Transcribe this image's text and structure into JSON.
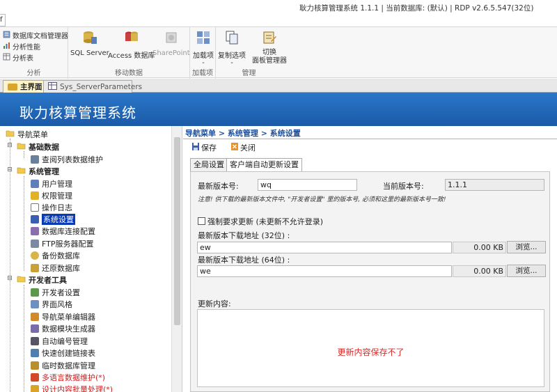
{
  "window": {
    "title": "耿力核算管理系统 1.1.1 | 当前数据库: (默认) | RDP v2.6.5.547(32位)",
    "tab_mark": "f"
  },
  "ribbon": {
    "groups": [
      {
        "name": "分析",
        "items": [
          "数据库文档管理器",
          "分析性能",
          "分析表"
        ]
      },
      {
        "name": "移动数据",
        "items": [
          "SQL Server",
          "Access 数据库",
          "SharePoint"
        ]
      },
      {
        "name": "加载项",
        "items": [
          "加载项"
        ]
      },
      {
        "name": "管理",
        "items": [
          "复制选项",
          "切换\n面板管理器"
        ]
      }
    ],
    "dropdown_marks": [
      "-",
      "-"
    ],
    "switch_line1": "切换",
    "switch_line2": "面板管理器"
  },
  "doc_tabs": [
    {
      "label": "主界面",
      "active": true
    },
    {
      "label": "Sys_ServerParameters",
      "active": false
    }
  ],
  "banner": {
    "title": "耿力核算管理系统"
  },
  "nav": {
    "root": "导航菜单",
    "categories": [
      {
        "label": "基础数据",
        "items": [
          "查阅列表数据维护"
        ]
      },
      {
        "label": "系统管理",
        "items": [
          "用户管理",
          "权限管理",
          "操作日志",
          "系统设置",
          "数据库连接配置",
          "FTP服务器配置",
          "备份数据库",
          "还原数据库"
        ]
      },
      {
        "label": "开发者工具",
        "items": [
          "开发者设置",
          "界面风格",
          "导航菜单编辑器",
          "数据模块生成器",
          "自动编号管理",
          "快速创建链接表",
          "临时数据库管理",
          "多语言数据维护(*)",
          "设计内容批量处理(*)"
        ]
      }
    ],
    "selected": "系统设置"
  },
  "main": {
    "breadcrumb": "导航菜单 > 系统管理 > 系统设置",
    "toolbar": {
      "save": "保存",
      "close": "关闭"
    },
    "tabs": [
      "全局设置",
      "客户端自动更新设置"
    ],
    "active_tab": "客户端自动更新设置",
    "form": {
      "latest_version_label": "最新版本号:",
      "latest_version_value": "wq",
      "current_version_label": "当前版本号:",
      "current_version_value": "1.1.1",
      "notice": "注意! 供下载的最新版本文件中, \"开发者设置\" 里的版本号, 必须和这里的最新版本号一致!",
      "force_update_label": "强制要求更新 (未更新不允许登录)",
      "force_update_checked": false,
      "url32_label": "最新版本下载地址 (32位) :",
      "url32_value": "ew",
      "url32_size": "0.00 KB",
      "url64_label": "最新版本下载地址 (64位) :",
      "url64_value": "we",
      "url64_size": "0.00 KB",
      "browse_label": "浏览...",
      "content_label": "更新内容:",
      "content_message": "更新内容保存不了"
    }
  },
  "colors": {
    "banner": "#1f63b5",
    "breadcrumb": "#1d4f9c",
    "selection": "#0a3bb5",
    "error_text": "#d92b2b"
  }
}
